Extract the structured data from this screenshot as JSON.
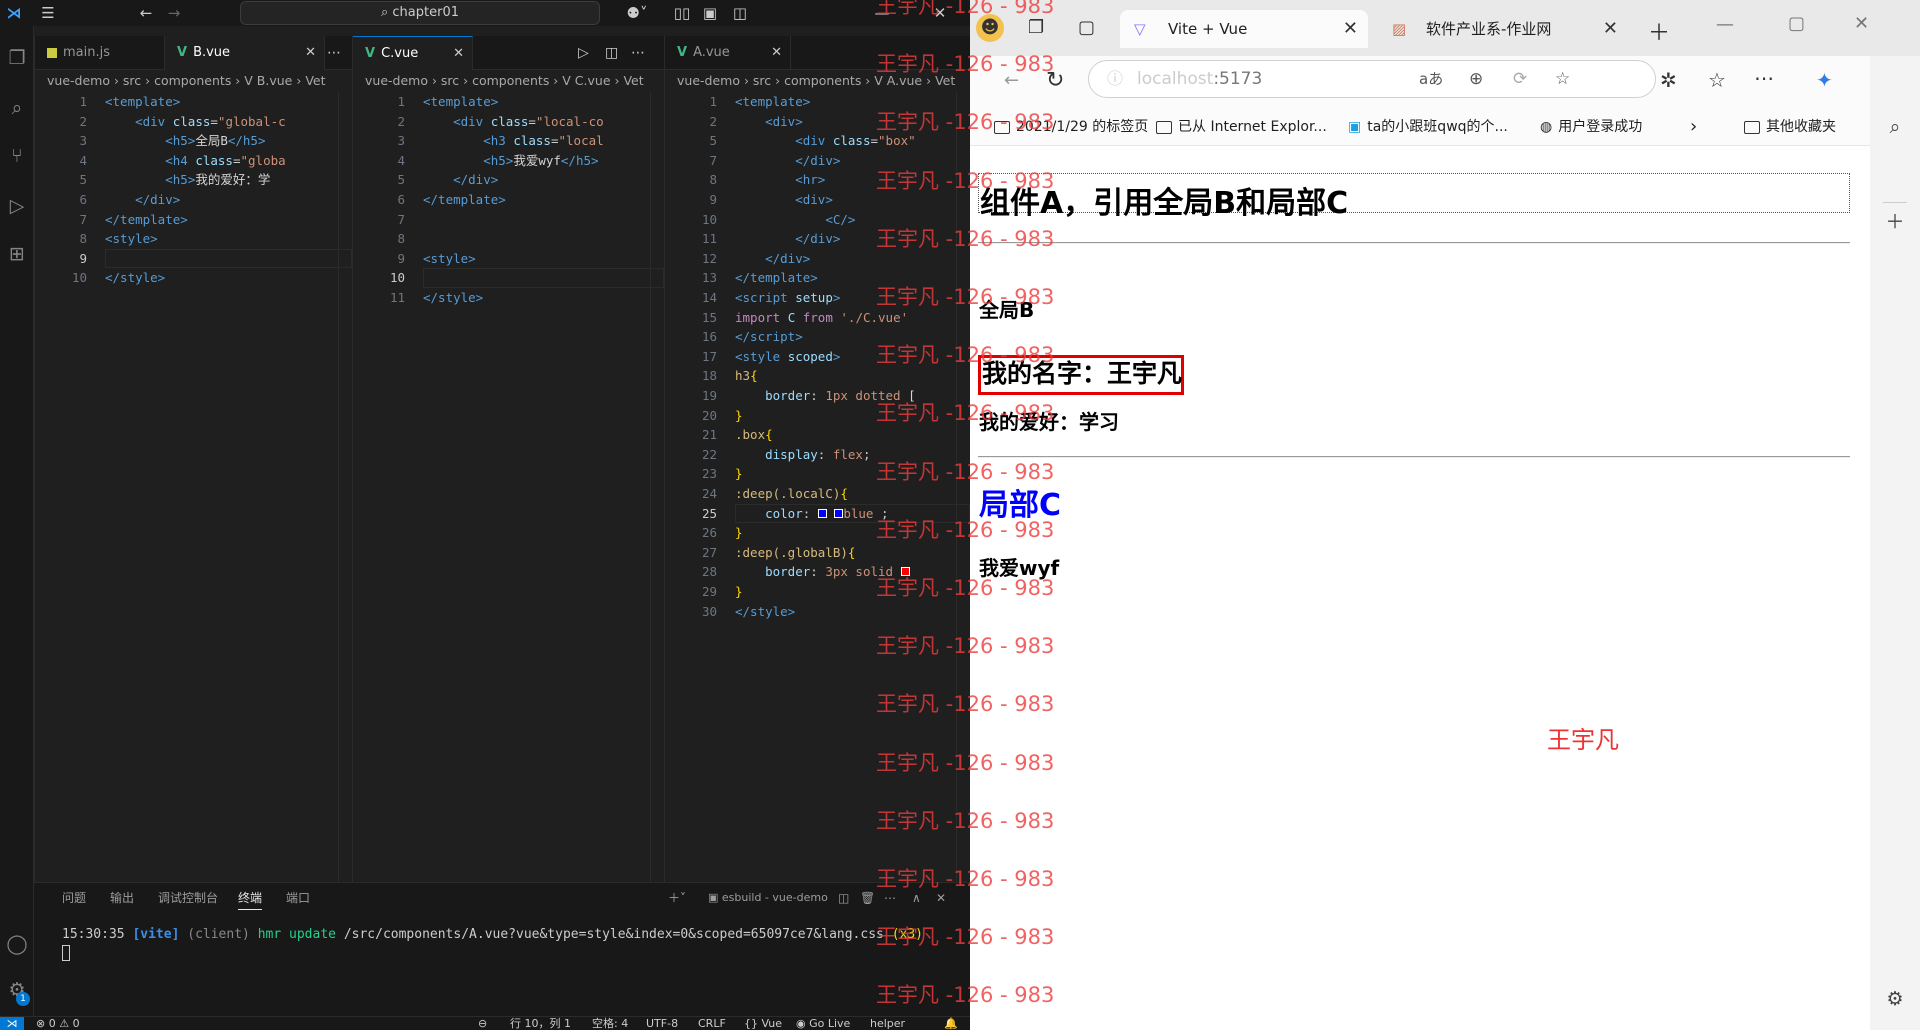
{
  "vscode": {
    "title": "chapter01",
    "editors": [
      {
        "tabs": [
          {
            "label": "main.js",
            "kind": "js",
            "active": false
          },
          {
            "label": "B.vue",
            "kind": "vue",
            "active": true
          }
        ],
        "breadcrumb": "vue-demo › src › components › V B.vue › Vet",
        "lines": [
          {
            "n": "1",
            "html": "<span class=\"tg\">&lt;template&gt;</span>"
          },
          {
            "n": "2",
            "html": "    <span class=\"tg\">&lt;div</span> <span class=\"at\">class</span>=<span class=\"st\">\"global-c</span>"
          },
          {
            "n": "3",
            "html": "        <span class=\"tg\">&lt;h5&gt;</span><span class=\"pl\">全局B</span><span class=\"tg\">&lt;/h5&gt;</span>"
          },
          {
            "n": "4",
            "html": "        <span class=\"tg\">&lt;h4</span> <span class=\"at\">class</span>=<span class=\"st\">\"globa</span>"
          },
          {
            "n": "5",
            "html": "        <span class=\"tg\">&lt;h5&gt;</span><span class=\"pl\">我的爱好：学</span>"
          },
          {
            "n": "6",
            "html": "    <span class=\"tg\">&lt;/div&gt;</span>"
          },
          {
            "n": "7",
            "html": "<span class=\"tg\">&lt;/template&gt;</span>"
          },
          {
            "n": "8",
            "html": "<span class=\"tg\">&lt;style&gt;</span>"
          },
          {
            "n": "9",
            "html": "",
            "cur": true
          },
          {
            "n": "10",
            "html": "<span class=\"tg\">&lt;/style&gt;</span>"
          }
        ]
      },
      {
        "tabs": [
          {
            "label": "C.vue",
            "kind": "vue",
            "active": true
          }
        ],
        "breadcrumb": "vue-demo › src › components › V C.vue › Vet",
        "lines": [
          {
            "n": "1",
            "html": "<span class=\"tg\">&lt;template&gt;</span>"
          },
          {
            "n": "2",
            "html": "    <span class=\"tg\">&lt;div</span> <span class=\"at\">class</span>=<span class=\"st\">\"local-co</span>"
          },
          {
            "n": "3",
            "html": "        <span class=\"tg\">&lt;h3</span> <span class=\"at\">class</span>=<span class=\"st\">\"local</span>"
          },
          {
            "n": "4",
            "html": "        <span class=\"tg\">&lt;h5&gt;</span><span class=\"pl\">我爱wyf</span><span class=\"tg\">&lt;/h5&gt;</span>"
          },
          {
            "n": "5",
            "html": "    <span class=\"tg\">&lt;/div&gt;</span>"
          },
          {
            "n": "6",
            "html": "<span class=\"tg\">&lt;/template&gt;</span>"
          },
          {
            "n": "7",
            "html": ""
          },
          {
            "n": "8",
            "html": ""
          },
          {
            "n": "9",
            "html": "<span class=\"tg\">&lt;style&gt;</span>"
          },
          {
            "n": "10",
            "html": "",
            "cur": true
          },
          {
            "n": "11",
            "html": "<span class=\"tg\">&lt;/style&gt;</span>"
          }
        ]
      },
      {
        "tabs": [
          {
            "label": "A.vue",
            "kind": "vue",
            "active": false
          }
        ],
        "breadcrumb": "vue-demo › src › components › V A.vue › Vet",
        "lines": [
          {
            "n": "1",
            "html": "<span class=\"tg\">&lt;template&gt;</span>"
          },
          {
            "n": "2",
            "html": "    <span class=\"tg\">&lt;div&gt;</span>"
          },
          {
            "n": "5",
            "html": "        <span class=\"tg\">&lt;div</span> <span class=\"at\">class</span>=<span class=\"st\">\"box\"</span>"
          },
          {
            "n": "7",
            "html": "        <span class=\"tg\">&lt;/div&gt;</span>"
          },
          {
            "n": "8",
            "html": "        <span class=\"tg\">&lt;hr&gt;</span>"
          },
          {
            "n": "9",
            "html": "        <span class=\"tg\">&lt;div&gt;</span>"
          },
          {
            "n": "10",
            "html": "            <span class=\"tg\">&lt;C/&gt;</span>"
          },
          {
            "n": "11",
            "html": "        <span class=\"tg\">&lt;/div&gt;</span>"
          },
          {
            "n": "12",
            "html": "    <span class=\"tg\">&lt;/div&gt;</span>"
          },
          {
            "n": "13",
            "html": "<span class=\"tg\">&lt;/template&gt;</span>"
          },
          {
            "n": "14",
            "html": "<span class=\"tg\">&lt;script</span> <span class=\"at\">setup</span><span class=\"tg\">&gt;</span>"
          },
          {
            "n": "15",
            "html": "<span class=\"kw\">import</span> <span class=\"at\">C</span> <span class=\"kw\">from</span> <span class=\"st\">'./C.vue'</span>"
          },
          {
            "n": "16",
            "html": "<span class=\"tg\">&lt;/script&gt;</span>"
          },
          {
            "n": "17",
            "html": "<span class=\"tg\">&lt;style</span> <span class=\"at\">scoped</span><span class=\"tg\">&gt;</span>"
          },
          {
            "n": "18",
            "html": "<span class=\"sel\">h3</span><span class=\"br\">{</span>"
          },
          {
            "n": "19",
            "html": "    <span class=\"pr\">border</span>: <span class=\"vl\">1px dotted</span> <span class=\"pl\">[</span>"
          },
          {
            "n": "20",
            "html": "<span class=\"br\">}</span>"
          },
          {
            "n": "21",
            "html": "<span class=\"sel\">.box</span><span class=\"br\">{</span>"
          },
          {
            "n": "22",
            "html": "    <span class=\"pr\">display</span>: <span class=\"vl\">flex</span>;"
          },
          {
            "n": "23",
            "html": "<span class=\"br\">}</span>"
          },
          {
            "n": "24",
            "html": "<span class=\"sel\">:deep(.localC)</span><span class=\"br\">{</span>"
          },
          {
            "n": "25",
            "html": "    <span class=\"pr\">color</span>: <span style=\"display:inline-block;width:9px;height:9px;border:1px solid #fff;background:#00f\"></span> <span style=\"display:inline-block;width:9px;height:9px;border:1px solid #fff;background:#00f\"></span><span class=\"vl\">blue</span> ;",
            "cur": true
          },
          {
            "n": "26",
            "html": "<span class=\"br\">}</span>"
          },
          {
            "n": "27",
            "html": "<span class=\"sel\">:deep(.globalB)</span><span class=\"br\">{</span>"
          },
          {
            "n": "28",
            "html": "    <span class=\"pr\">border</span>: <span class=\"vl\">3px solid</span> <span style=\"display:inline-block;width:9px;height:9px;border:1px solid #fff;background:#f00\"></span>"
          },
          {
            "n": "29",
            "html": "<span class=\"br\">}</span>"
          },
          {
            "n": "30",
            "html": "<span class=\"tg\">&lt;/style&gt;</span>"
          }
        ]
      }
    ],
    "panel": {
      "tabs": [
        "问题",
        "输出",
        "调试控制台",
        "终端",
        "端口"
      ],
      "active_tab": "终端",
      "terminal_name": "esbuild - vue-demo",
      "terminal": {
        "time": "15:30:35",
        "tag": "[vite]",
        "client": "(client)",
        "hmr": "hmr update",
        "path": "/src/components/A.vue?vue&type=style&index=0&scoped=65097ce7&lang.css",
        "count": "(x3)"
      }
    },
    "status": {
      "errors": "⊗ 0 ⚠ 0",
      "position": "行 10，列 1",
      "spaces": "空格: 4",
      "encoding": "UTF-8",
      "eol": "CRLF",
      "language": "{} Vue",
      "golive": "◉ Go Live",
      "helper": "helper",
      "badge": "1"
    }
  },
  "edge": {
    "tabs": [
      {
        "label": "Vite + Vue",
        "active": true
      },
      {
        "label": "软件产业系-作业网",
        "active": false
      }
    ],
    "url_host": "localhost",
    "url_port": ":5173",
    "translate_icon": "aあ",
    "bookmarks": [
      {
        "label": "2021/1/29 的标签页"
      },
      {
        "label": "已从 Internet Explor..."
      },
      {
        "label": "ta的小跟班qwq的个..."
      },
      {
        "label": "用户登录成功"
      },
      {
        "label": "其他收藏夹"
      }
    ],
    "page": {
      "h1": "组件A，引用全局B和局部C",
      "global_b": "全局B",
      "name": "我的名字：王宇凡",
      "hobby": "我的爱好：学习",
      "local_c": "局部C",
      "love": "我爱wyf",
      "signature": "王宇凡"
    }
  },
  "watermark": "王宇凡 -126 - 983",
  "colors": {
    "accent": "#0078d4",
    "vue_green": "#41b883",
    "local_c_blue": "#0000ff",
    "name_border": "#e00000",
    "watermark": "#ee3b3b"
  }
}
